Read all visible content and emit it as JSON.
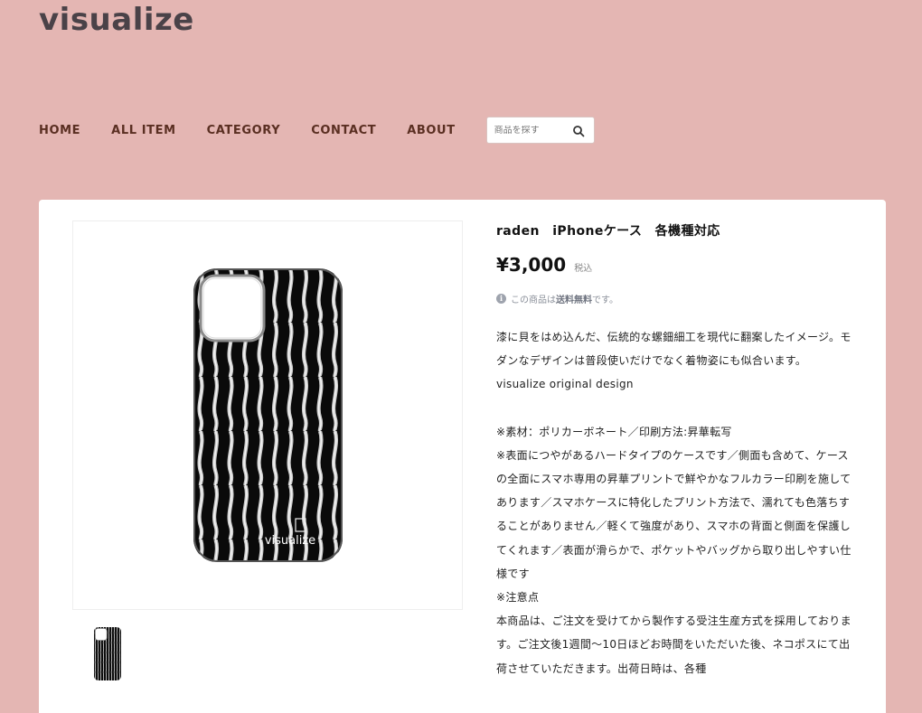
{
  "site": {
    "logo": "visualize"
  },
  "nav": {
    "items": [
      "HOME",
      "ALL ITEM",
      "CATEGORY",
      "CONTACT",
      "ABOUT"
    ],
    "search_placeholder": "商品を探す"
  },
  "product": {
    "title": "raden　iPhoneケース　各機種対応",
    "price": "¥3,000",
    "tax_label": "税込",
    "shipping_prefix": "この商品は",
    "shipping_bold": "送料無料",
    "shipping_suffix": "です。",
    "image_brand": "visualize",
    "description": [
      "漆に貝をはめ込んだ、伝統的な螺鈿細工を現代に翻案したイメージ。モダンなデザインは普段使いだけでなく着物姿にも似合います。",
      "visualize original design",
      "",
      "※素材：ポリカーボネート／印刷方法:昇華転写",
      "※表面につやがあるハードタイプのケースです／側面も含めて、ケースの全面にスマホ専用の昇華プリントで鮮やかなフルカラー印刷を施してあります／スマホケースに特化したプリント方法で、濡れても色落ちすることがありません／軽くて強度があり、スマホの背面と側面を保護してくれます／表面が滑らかで、ポケットやバッグから取り出しやすい仕様です",
      "※注意点",
      "本商品は、ご注文を受けてから製作する受注生産方式を採用しております。ご注文後1週間〜10日ほどお時間をいただいた後、ネコポスにて出荷させていただきます。出荷日時は、各種"
    ]
  },
  "colors": {
    "background": "#e4b6b3",
    "nav_text": "#5a2f22",
    "logo_text": "#4a4248"
  }
}
